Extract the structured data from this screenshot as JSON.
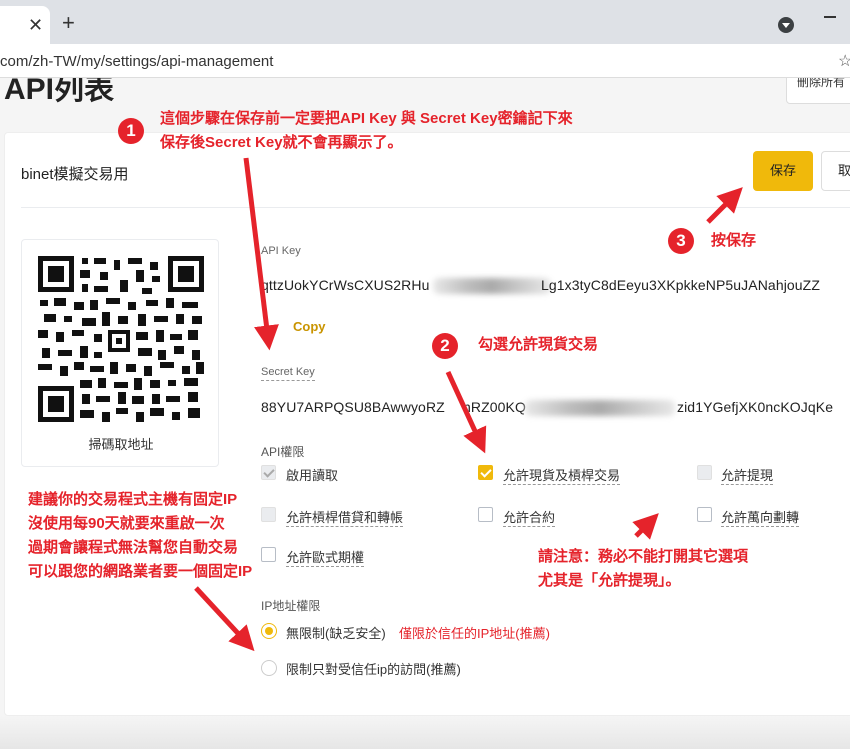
{
  "browser": {
    "tab_close": "✕",
    "new_tab": "+",
    "url": "com/zh-TW/my/settings/api-management",
    "bookmark_icon": "star-icon"
  },
  "page": {
    "title": "API列表",
    "delete_all_label": "刪除所有"
  },
  "api_card": {
    "name": "binet模擬交易用",
    "save_label": "保存",
    "cancel_label": "取",
    "qr_caption": "掃碼取地址",
    "api_key_label": "API Key",
    "api_key_start": "qttzUokYCrWsCXUS2RHu",
    "api_key_end": "Lg1x3tyC8dEeyu3XKpkkeNP5uJANahjouZZ",
    "copy_label": "Copy",
    "secret_key_label": "Secret Key",
    "secret_key_start": "88YU7ARPQSU8BAwwyoRZ",
    "secret_key_mid": "nRZ00KQ",
    "secret_key_end": "zid1YGefjXK0ncKOJqKe",
    "permissions_label": "API權限",
    "permissions": {
      "read": "啟用讀取",
      "spot": "允許現貨及槓桿交易",
      "withdraw": "允許提現",
      "margin": "允許槓桿借貸和轉帳",
      "futures": "允許合約",
      "universal_transfer": "允許萬向劃轉",
      "options": "允許歐式期權"
    },
    "ip_label": "IP地址權限",
    "ip_unrestricted": "無限制(缺乏安全)",
    "ip_unrestricted_hint": "僅限於信任的IP地址(推薦)",
    "ip_restricted": "限制只對受信任ip的訪問(推薦)"
  },
  "annotations": {
    "step1_num": "1",
    "step1_line1": "這個步驟在保存前一定要把API Key 與 Secret Key密鑰記下來",
    "step1_line2": "保存後Secret Key就不會再顯示了。",
    "step2_num": "2",
    "step2_text": "勾選允許現貨交易",
    "step3_num": "3",
    "step3_text": "按保存",
    "ip_note_1": "建議你的交易程式主機有固定IP",
    "ip_note_2": "沒使用每90天就要來重啟一次",
    "ip_note_3": "過期會讓程式無法幫您自動交易",
    "ip_note_4": "可以跟您的網路業者要一個固定IP",
    "warn_1": "請注意：務必不能打開其它選項",
    "warn_2": "尤其是「允許提現」。"
  },
  "colors": {
    "accent": "#f0b90b",
    "annotation_red": "#e5232b"
  }
}
